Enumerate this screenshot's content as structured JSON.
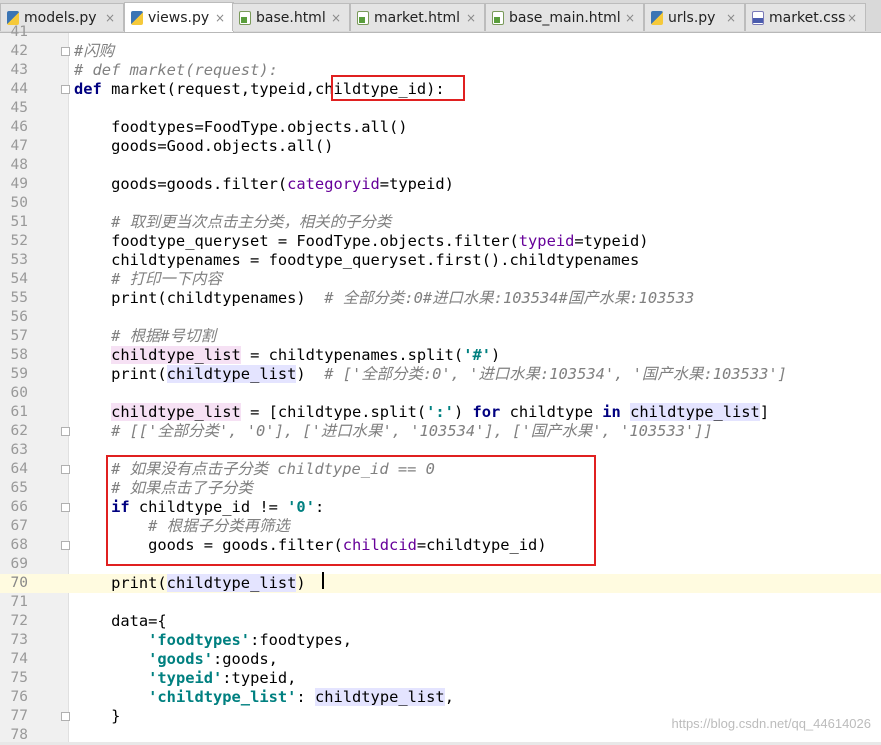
{
  "tabs": [
    {
      "label": "models.py",
      "icon": "python-file-icon",
      "active": false
    },
    {
      "label": "views.py",
      "icon": "python-file-icon",
      "active": true
    },
    {
      "label": "base.html",
      "icon": "html-file-icon",
      "active": false
    },
    {
      "label": "market.html",
      "icon": "html-file-icon",
      "active": false
    },
    {
      "label": "base_main.html",
      "icon": "html-file-icon",
      "active": false
    },
    {
      "label": "urls.py",
      "icon": "python-file-icon",
      "active": false
    },
    {
      "label": "market.css",
      "icon": "css-file-icon",
      "active": false
    }
  ],
  "close_glyph": "×",
  "current_line": 70,
  "watermark": "https://blog.csdn.net/qq_44614026",
  "lines": [
    {
      "n": "41",
      "tokens": []
    },
    {
      "n": "42",
      "tokens": [
        [
          "cm",
          "#闪购"
        ]
      ]
    },
    {
      "n": "43",
      "tokens": [
        [
          "cm",
          "# def market(request):"
        ]
      ]
    },
    {
      "n": "44",
      "tokens": [
        [
          "kw",
          "def"
        ],
        [
          "",
          " market(request,typeid,"
        ],
        [
          "",
          "childtype_id"
        ],
        [
          "",
          "):"
        ]
      ]
    },
    {
      "n": "45",
      "tokens": []
    },
    {
      "n": "46",
      "tokens": [
        [
          "",
          "    foodtypes=FoodType.objects.all()"
        ]
      ]
    },
    {
      "n": "47",
      "tokens": [
        [
          "",
          "    goods=Good.objects.all()"
        ]
      ]
    },
    {
      "n": "48",
      "tokens": []
    },
    {
      "n": "49",
      "tokens": [
        [
          "",
          "    goods=goods.filter("
        ],
        [
          "pm",
          "categoryid"
        ],
        [
          "",
          "=typeid)"
        ]
      ]
    },
    {
      "n": "50",
      "tokens": []
    },
    {
      "n": "51",
      "tokens": [
        [
          "",
          "    "
        ],
        [
          "cm",
          "# 取到更当次点击主分类，相关的子分类"
        ]
      ]
    },
    {
      "n": "52",
      "tokens": [
        [
          "",
          "    foodtype_queryset = FoodType.objects.filter("
        ],
        [
          "pm",
          "typeid"
        ],
        [
          "",
          "=typeid)"
        ]
      ]
    },
    {
      "n": "53",
      "tokens": [
        [
          "",
          "    childtypenames = foodtype_queryset.first().childtypenames"
        ]
      ]
    },
    {
      "n": "54",
      "tokens": [
        [
          "",
          "    "
        ],
        [
          "cm",
          "# 打印一下内容"
        ]
      ]
    },
    {
      "n": "55",
      "tokens": [
        [
          "",
          "    "
        ],
        [
          "kw0",
          "print"
        ],
        [
          "",
          "(childtypenames)  "
        ],
        [
          "cm",
          "# 全部分类:0#进口水果:103534#国产水果:103533"
        ]
      ]
    },
    {
      "n": "56",
      "tokens": []
    },
    {
      "n": "57",
      "tokens": [
        [
          "",
          "    "
        ],
        [
          "cm",
          "# 根据#号切割"
        ]
      ]
    },
    {
      "n": "58",
      "tokens": [
        [
          "",
          "    "
        ],
        [
          "hl",
          "childtype_list"
        ],
        [
          "",
          " = childtypenames.split("
        ],
        [
          "st",
          "'#'"
        ],
        [
          "",
          ")"
        ]
      ]
    },
    {
      "n": "59",
      "tokens": [
        [
          "",
          "    print("
        ],
        [
          "hl2",
          "childtype_list"
        ],
        [
          "",
          ")  "
        ],
        [
          "cm",
          "# ['全部分类:0', '进口水果:103534', '国产水果:103533']"
        ]
      ]
    },
    {
      "n": "60",
      "tokens": []
    },
    {
      "n": "61",
      "tokens": [
        [
          "",
          "    "
        ],
        [
          "hl",
          "childtype_list"
        ],
        [
          "",
          " = [childtype.split("
        ],
        [
          "st",
          "':'"
        ],
        [
          "",
          ") "
        ],
        [
          "kw",
          "for"
        ],
        [
          "",
          " childtype "
        ],
        [
          "kw",
          "in"
        ],
        [
          "",
          " "
        ],
        [
          "hl2",
          "childtype_list"
        ],
        [
          "",
          "]"
        ]
      ]
    },
    {
      "n": "62",
      "tokens": [
        [
          "",
          "    "
        ],
        [
          "cm",
          "# [['全部分类', '0'], ['进口水果', '103534'], ['国产水果', '103533']]"
        ]
      ]
    },
    {
      "n": "63",
      "tokens": []
    },
    {
      "n": "64",
      "tokens": [
        [
          "",
          "    "
        ],
        [
          "cm",
          "# 如果没有点击子分类 childtype_id == 0"
        ]
      ]
    },
    {
      "n": "65",
      "tokens": [
        [
          "",
          "    "
        ],
        [
          "cm",
          "# 如果点击了子分类"
        ]
      ]
    },
    {
      "n": "66",
      "tokens": [
        [
          "",
          "    "
        ],
        [
          "kw",
          "if"
        ],
        [
          "",
          " childtype_id != "
        ],
        [
          "st",
          "'0'"
        ],
        [
          "",
          ":"
        ]
      ]
    },
    {
      "n": "67",
      "tokens": [
        [
          "",
          "        "
        ],
        [
          "cm",
          "# 根据子分类再筛选"
        ]
      ]
    },
    {
      "n": "68",
      "tokens": [
        [
          "",
          "        goods = goods.filter("
        ],
        [
          "pm",
          "childcid"
        ],
        [
          "",
          "=childtype_id)"
        ]
      ]
    },
    {
      "n": "69",
      "tokens": []
    },
    {
      "n": "70",
      "tokens": [
        [
          "",
          "    print("
        ],
        [
          "hl2",
          "childtype_list"
        ],
        [
          "",
          ")"
        ]
      ]
    },
    {
      "n": "71",
      "tokens": []
    },
    {
      "n": "72",
      "tokens": [
        [
          "",
          "    data={"
        ]
      ]
    },
    {
      "n": "73",
      "tokens": [
        [
          "",
          "        "
        ],
        [
          "st",
          "'foodtypes'"
        ],
        [
          "",
          ":foodtypes,"
        ]
      ]
    },
    {
      "n": "74",
      "tokens": [
        [
          "",
          "        "
        ],
        [
          "st",
          "'goods'"
        ],
        [
          "",
          ":goods,"
        ]
      ]
    },
    {
      "n": "75",
      "tokens": [
        [
          "",
          "        "
        ],
        [
          "st",
          "'typeid'"
        ],
        [
          "",
          ":typeid,"
        ]
      ]
    },
    {
      "n": "76",
      "tokens": [
        [
          "",
          "        "
        ],
        [
          "st",
          "'childtype_list'"
        ],
        [
          "",
          ": "
        ],
        [
          "hl2",
          "childtype_list"
        ],
        [
          "",
          ","
        ]
      ]
    },
    {
      "n": "77",
      "tokens": [
        [
          "",
          "    }"
        ]
      ]
    },
    {
      "n": "78",
      "tokens": []
    }
  ]
}
